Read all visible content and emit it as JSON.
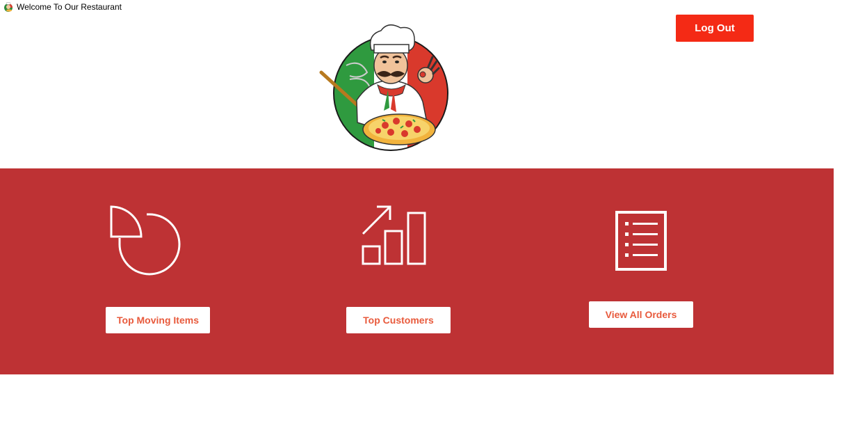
{
  "window": {
    "title": "Welcome To Our Restaurant",
    "icon": "chef-icon"
  },
  "header": {
    "logout_label": "Log Out",
    "logo": "chef-with-pizza-logo"
  },
  "panel": {
    "cards": [
      {
        "icon": "pie-chart-icon",
        "label": "Top Moving Items"
      },
      {
        "icon": "bar-chart-growth-icon",
        "label": "Top Customers"
      },
      {
        "icon": "list-document-icon",
        "label": "View All Orders"
      }
    ]
  },
  "colors": {
    "panel_bg": "#BE3234",
    "logout_bg": "#F42A15",
    "button_text": "#E85A3C",
    "icon_stroke": "#FFFFFF"
  }
}
